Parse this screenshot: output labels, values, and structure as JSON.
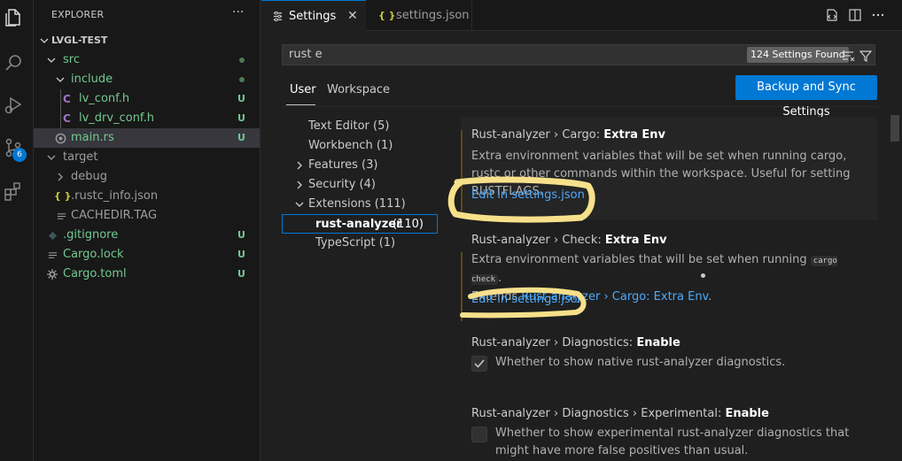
{
  "explorer": {
    "header": "EXPLORER",
    "more": "···",
    "items": [
      {
        "label": "LVGL-TEST",
        "status": ""
      },
      {
        "label": "src",
        "status": "dot"
      },
      {
        "label": "include",
        "status": "dot"
      },
      {
        "label": "lv_conf.h",
        "icon": "C",
        "status": "U"
      },
      {
        "label": "lv_drv_conf.h",
        "icon": "C",
        "status": "U"
      },
      {
        "label": "main.rs",
        "status": "U"
      },
      {
        "label": "target",
        "status": ""
      },
      {
        "label": "debug",
        "status": ""
      },
      {
        "label": ".rustc_info.json",
        "icon": "{ }",
        "status": ""
      },
      {
        "label": "CACHEDIR.TAG",
        "status": ""
      },
      {
        "label": ".gitignore",
        "status": "U"
      },
      {
        "label": "Cargo.lock",
        "status": "U"
      },
      {
        "label": "Cargo.toml",
        "status": "U"
      }
    ]
  },
  "activity": {
    "source_control_badge": "6"
  },
  "tabs": [
    {
      "label": "Settings",
      "icon": "settings-icon",
      "close": "✕"
    },
    {
      "label": "settings.json",
      "icon": "{ }"
    }
  ],
  "settings": {
    "search_value": "rust e",
    "found": "124 Settings Found",
    "scopes": [
      "User",
      "Workspace"
    ],
    "sync_button": "Backup and Sync Settings",
    "toc": [
      {
        "label": "Text Editor (5)"
      },
      {
        "label": "Workbench (1)"
      },
      {
        "label": "Features (3)"
      },
      {
        "label": "Security (4)"
      },
      {
        "label": "Extensions (111)"
      },
      {
        "label": "rust-analyzer",
        "count": "(110)"
      },
      {
        "label": "TypeScript (1)"
      }
    ],
    "items": [
      {
        "prefix": "Rust-analyzer › Cargo: ",
        "name": "Extra Env",
        "desc": "Extra environment variables that will be set when running cargo, rustc or other commands within the workspace. Useful for setting RUSTFLAGS.",
        "link": "Edit in settings.json"
      },
      {
        "prefix": "Rust-analyzer › Check: ",
        "name": "Extra Env",
        "desc_before": "Extra environment variables that will be set when running",
        "code": "cargo check",
        "desc_after": ".",
        "extends_label": "Extends",
        "extends_link": "Rust-analyzer › Cargo: Extra Env",
        "extends_end": ".",
        "link": "Edit in settings.json"
      },
      {
        "prefix": "Rust-analyzer › Diagnostics: ",
        "name": "Enable",
        "checked": true,
        "desc": "Whether to show native rust-analyzer diagnostics."
      },
      {
        "prefix": "Rust-analyzer › Diagnostics › Experimental: ",
        "name": "Enable",
        "checked": false,
        "desc": "Whether to show experimental rust-analyzer diagnostics that might have more false positives than usual."
      }
    ]
  },
  "colors": {
    "accent": "#0078d4",
    "git_untracked": "#73c991",
    "highlight_annotation": "#f7e08a"
  }
}
